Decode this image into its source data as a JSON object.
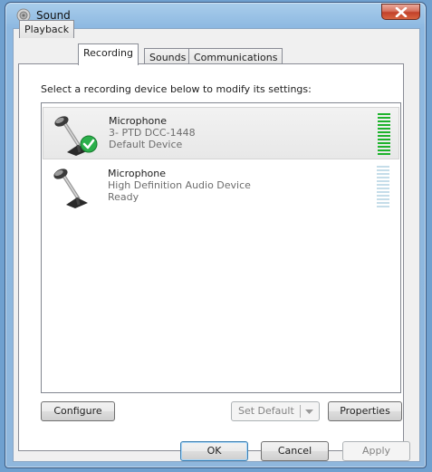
{
  "window": {
    "title": "Sound"
  },
  "tabs": [
    {
      "label": "Playback"
    },
    {
      "label": "Recording"
    },
    {
      "label": "Sounds"
    },
    {
      "label": "Communications"
    }
  ],
  "recording": {
    "instruction": "Select a recording device below to modify its settings:",
    "devices": [
      {
        "name": "Microphone",
        "line1": "3- PTD DCC-1448",
        "line2": "Default Device",
        "selected": true,
        "level": 1.0
      },
      {
        "name": "Microphone",
        "line1": "High Definition Audio Device",
        "line2": "Ready",
        "selected": false,
        "level": 0.0
      }
    ],
    "buttons": {
      "configure": "Configure",
      "set_default": "Set Default",
      "properties": "Properties"
    }
  },
  "footer": {
    "ok": "OK",
    "cancel": "Cancel",
    "apply": "Apply"
  },
  "icons": {
    "window_icon": "speaker-icon",
    "close": "close-icon",
    "device_icon": "microphone-icon",
    "default_badge": "checkmark-icon",
    "dropdown": "chevron-down-icon"
  },
  "colors": {
    "meter_active": "#1db32c",
    "meter_idle": "#c5dde9"
  }
}
